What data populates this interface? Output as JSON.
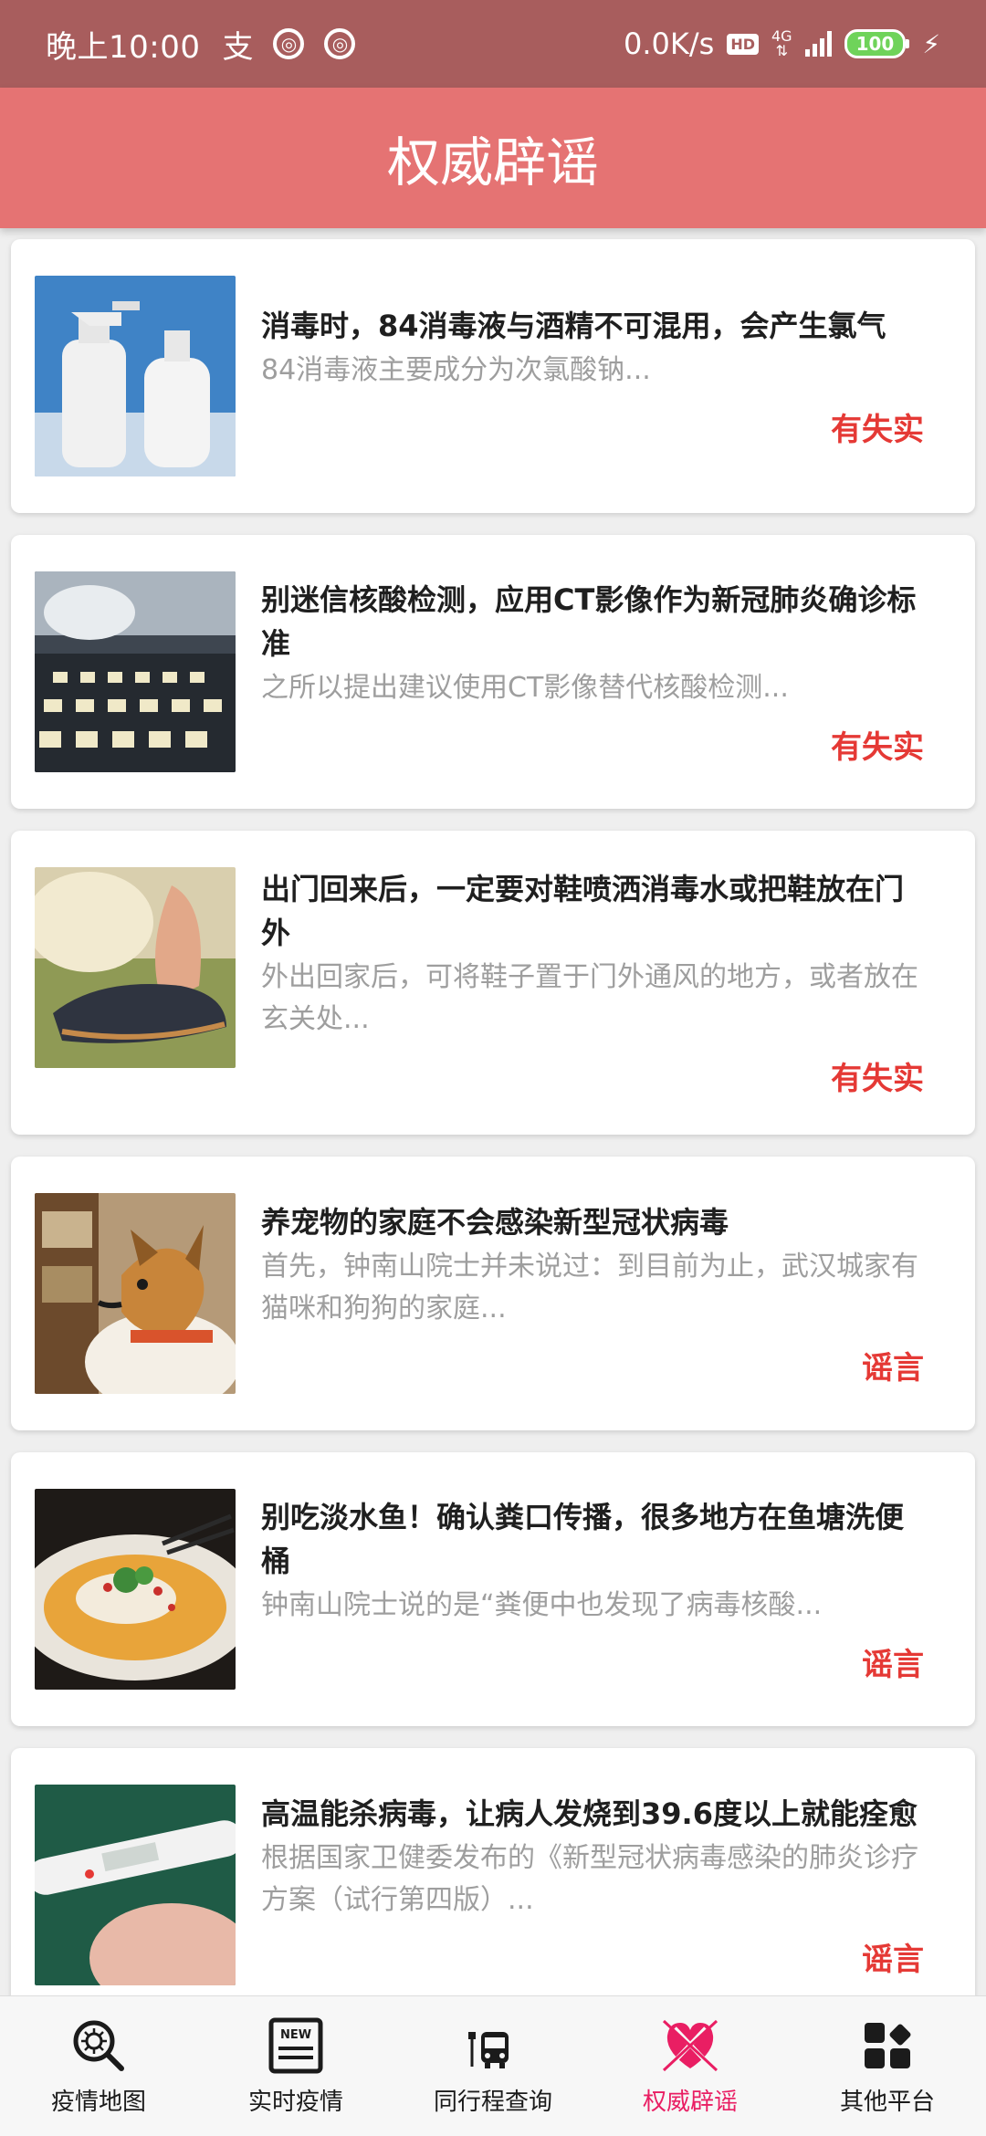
{
  "status_bar": {
    "time": "晚上10:00",
    "speed": "0.0K/s",
    "hd": "HD",
    "network": "4G",
    "battery": "100"
  },
  "header": {
    "title": "权威辟谣"
  },
  "cards": [
    {
      "title": "消毒时，84消毒液与酒精不可混用，会产生氯气",
      "summary": "84消毒液主要成分为次氯酸钠...",
      "verdict": "有失实"
    },
    {
      "title": "别迷信核酸检测，应用CT影像作为新冠肺炎确诊标准",
      "summary": "之所以提出建议使用CT影像替代核酸检测...",
      "verdict": "有失实"
    },
    {
      "title": "出门回来后，一定要对鞋喷洒消毒水或把鞋放在门外",
      "summary": "外出回家后，可将鞋子置于门外通风的地方，或者放在玄关处...",
      "verdict": "有失实"
    },
    {
      "title": "养宠物的家庭不会感染新型冠状病毒",
      "summary": "首先，钟南山院士并未说过：到目前为止，武汉城家有猫咪和狗狗的家庭...",
      "verdict": "谣言"
    },
    {
      "title": "别吃淡水鱼！确认粪口传播，很多地方在鱼塘洗便桶",
      "summary": "钟南山院士说的是“粪便中也发现了病毒核酸...",
      "verdict": "谣言"
    },
    {
      "title": "高温能杀病毒，让病人发烧到39.6度以上就能痊愈",
      "summary": "根据国家卫健委发布的《新型冠状病毒感染的肺炎诊疗方案（试行第四版）...",
      "verdict": "谣言"
    }
  ],
  "bottom_nav": [
    {
      "label": "疫情地图",
      "icon": "virus-search-icon"
    },
    {
      "label": "实时疫情",
      "icon": "news-icon"
    },
    {
      "label": "同行程查询",
      "icon": "bus-icon"
    },
    {
      "label": "权威辟谣",
      "icon": "rumor-icon",
      "active": true
    },
    {
      "label": "其他平台",
      "icon": "apps-icon"
    }
  ],
  "colors": {
    "status_bar": "#a85d5d",
    "header": "#e57373",
    "verdict": "#e53935",
    "active_tab": "#e91e63"
  },
  "nav_icon_text": "NEW"
}
